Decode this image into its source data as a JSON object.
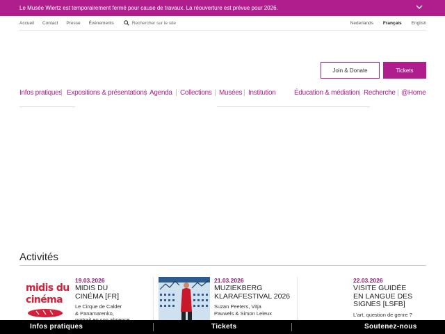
{
  "banner": {
    "text": "Le Musée Wiertz est temporairement fermé pour cause de travaux. La réouverture est prévue pour 2026.",
    "icon": "chevron-down-icon"
  },
  "utility": {
    "links": [
      "Accueil",
      "Contact",
      "Presse",
      "Événements"
    ],
    "search_placeholder": "Rechercher sur le site",
    "languages": [
      "Nederlands",
      "Français",
      "English"
    ],
    "active_language": "Français"
  },
  "actions": {
    "join_label": "Join & Donate",
    "tickets_label": "Tickets"
  },
  "mainnav": {
    "items": [
      "Infos pratiques",
      "Expositions & présentations",
      "Agenda",
      "Collections",
      "Musées",
      "Institution",
      "Éducation & médiation",
      "Recherche",
      "@Home"
    ]
  },
  "activities": {
    "title": "Activités",
    "cards": [
      {
        "date": "19.03.2026",
        "title_lines": [
          "Midis du",
          "cinéma [FR]"
        ],
        "sub_lines": [
          "Le Cirque de Calder",
          "& Panamarenko,",
          "portrait en son absence"
        ],
        "thumb_text": [
          "midis du",
          "cinéma"
        ]
      },
      {
        "date": "21.03.2026",
        "title_lines": [
          "Muziekberg",
          "Klarafestival 2026"
        ],
        "sub_lines": [
          "Suzan Peeters, Vitja",
          "Pauwels & Simon Leleux"
        ]
      },
      {
        "date": "22.03.2026",
        "title_lines": [
          "Visite guidée",
          "en langue des",
          "signes [LSFB]"
        ],
        "sub_lines": [
          "L'art, question de genre ?"
        ]
      }
    ]
  },
  "bottombar": {
    "items": [
      "Infos pratiques",
      "Tickets",
      "Soutenez-nous"
    ]
  },
  "colors": {
    "accent": "#b01e8e",
    "date": "#8c1a6e",
    "bottombar": "#000000"
  }
}
